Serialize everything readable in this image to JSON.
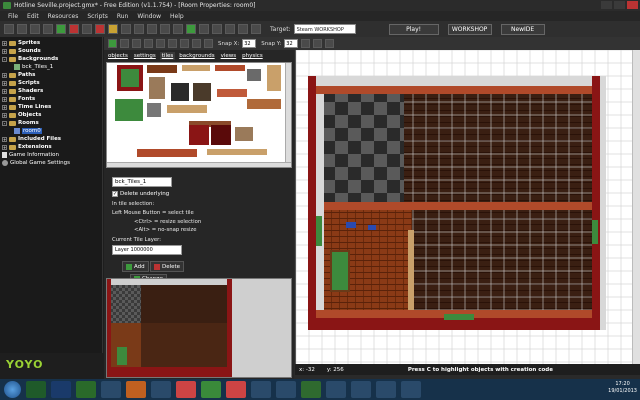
{
  "window": {
    "title": "Hotline Seville.project.gmx*  -  Free Edition (v1.1.754)  -  [Room Properties: room0]"
  },
  "menu": [
    "File",
    "Edit",
    "Resources",
    "Scripts",
    "Run",
    "Window",
    "Help"
  ],
  "toolbar": {
    "target_label": "Target:",
    "target_value": "Steam WORKSHOP",
    "play_label": "Play!",
    "workshop_label": "WORKSHOP",
    "newide_label": "NewIDE"
  },
  "tree": [
    {
      "label": "Sprites",
      "kind": "folder",
      "bold": true,
      "fold": "+"
    },
    {
      "label": "Sounds",
      "kind": "folder",
      "bold": true,
      "fold": "+"
    },
    {
      "label": "Backgrounds",
      "kind": "folder",
      "bold": true,
      "fold": "-"
    },
    {
      "label": "bck_Tiles_1",
      "kind": "tile",
      "bold": false,
      "fold": ""
    },
    {
      "label": "Paths",
      "kind": "folder",
      "bold": true,
      "fold": "+"
    },
    {
      "label": "Scripts",
      "kind": "folder",
      "bold": true,
      "fold": "+"
    },
    {
      "label": "Shaders",
      "kind": "folder",
      "bold": true,
      "fold": "+"
    },
    {
      "label": "Fonts",
      "kind": "folder",
      "bold": true,
      "fold": "+"
    },
    {
      "label": "Time Lines",
      "kind": "folder",
      "bold": true,
      "fold": "+"
    },
    {
      "label": "Objects",
      "kind": "folder",
      "bold": true,
      "fold": "+"
    },
    {
      "label": "Rooms",
      "kind": "folder",
      "bold": true,
      "fold": "-"
    },
    {
      "label": "room0",
      "kind": "room",
      "bold": false,
      "fold": "",
      "selected": true
    },
    {
      "label": "Included Files",
      "kind": "folder",
      "bold": true,
      "fold": "+"
    },
    {
      "label": "Extensions",
      "kind": "folder",
      "bold": true,
      "fold": "+"
    },
    {
      "label": "Game Information",
      "kind": "doc",
      "bold": false,
      "fold": ""
    },
    {
      "label": "Global Game Settings",
      "kind": "gear",
      "bold": false,
      "fold": ""
    }
  ],
  "branding": {
    "logo_text": "YOYO"
  },
  "room_toolbar": {
    "snap_x_label": "Snap X:",
    "snap_x": "32",
    "snap_y_label": "Snap Y:",
    "snap_y": "32"
  },
  "tabs": [
    "objects",
    "settings",
    "tiles",
    "backgrounds",
    "views",
    "physics"
  ],
  "tiles_panel": {
    "background_select": "bck_Tiles_1",
    "delete_underlying": "Delete underlying",
    "info_lines": [
      "In tile selection:",
      "Left Mouse Button = select tile",
      "<Ctrl> = resize selection",
      "<Alt> = no-snap resize"
    ],
    "layer_label": "Current Tile Layer:",
    "layer_value": "Layer 1000000",
    "add_label": "Add",
    "delete_label": "Delete",
    "change_label": "Change"
  },
  "status": {
    "x": "x: -32",
    "y": "y: 256",
    "hint": "Press C to highlight objects with creation code"
  },
  "taskbar": {
    "time": "17:20",
    "date": "19/01/2013"
  },
  "colors": {
    "wall_red": "#8a1515",
    "wood": "#7a3a18",
    "checker_dark": "#2a2a2a",
    "checker_light": "#5a5a5a",
    "floor_dark": "#3a1f12",
    "grid": "#cfcfcf",
    "pool_green": "#3d8a3d",
    "accent_green": "#9ad234"
  }
}
